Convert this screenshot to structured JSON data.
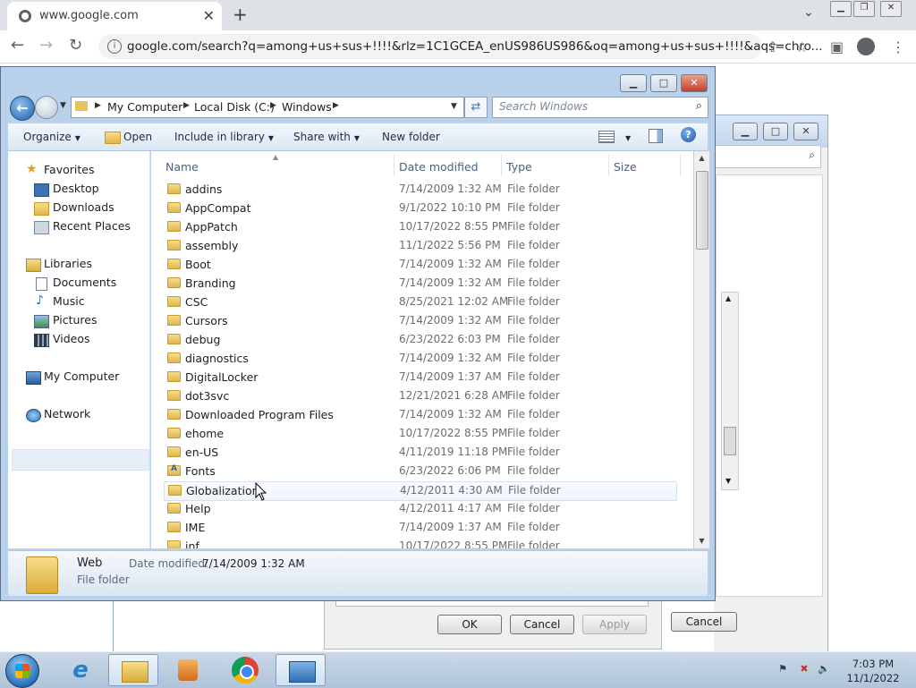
{
  "browser": {
    "tab_title": "www.google.com",
    "url": "google.com/search?q=among+us+sus+!!!!&rlz=1C1GCEA_enUS986US986&oq=among+us+sus+!!!!&aqs=chro..."
  },
  "background_dialog": {
    "ok_label": "OK",
    "cancel_label": "Cancel",
    "apply_label": "Apply",
    "outer_cancel_label": "Cancel"
  },
  "explorer": {
    "breadcrumbs": [
      "My Computer",
      "Local Disk (C:)",
      "Windows"
    ],
    "search_placeholder": "Search Windows",
    "commands": {
      "organize": "Organize",
      "open": "Open",
      "include_in_library": "Include in library",
      "share_with": "Share with",
      "new_folder": "New folder"
    },
    "nav": {
      "favorites": "Favorites",
      "desktop": "Desktop",
      "downloads": "Downloads",
      "recent_places": "Recent Places",
      "libraries": "Libraries",
      "documents": "Documents",
      "music": "Music",
      "pictures": "Pictures",
      "videos": "Videos",
      "my_computer": "My Computer",
      "network": "Network"
    },
    "columns": {
      "name": "Name",
      "date_modified": "Date modified",
      "type": "Type",
      "size": "Size"
    },
    "files": [
      {
        "name": "addins",
        "date": "7/14/2009 1:32 AM",
        "type": "File folder"
      },
      {
        "name": "AppCompat",
        "date": "9/1/2022 10:10 PM",
        "type": "File folder"
      },
      {
        "name": "AppPatch",
        "date": "10/17/2022 8:55 PM",
        "type": "File folder"
      },
      {
        "name": "assembly",
        "date": "11/1/2022 5:56 PM",
        "type": "File folder"
      },
      {
        "name": "Boot",
        "date": "7/14/2009 1:32 AM",
        "type": "File folder"
      },
      {
        "name": "Branding",
        "date": "7/14/2009 1:32 AM",
        "type": "File folder"
      },
      {
        "name": "CSC",
        "date": "8/25/2021 12:02 AM",
        "type": "File folder"
      },
      {
        "name": "Cursors",
        "date": "7/14/2009 1:32 AM",
        "type": "File folder"
      },
      {
        "name": "debug",
        "date": "6/23/2022 6:03 PM",
        "type": "File folder"
      },
      {
        "name": "diagnostics",
        "date": "7/14/2009 1:32 AM",
        "type": "File folder"
      },
      {
        "name": "DigitalLocker",
        "date": "7/14/2009 1:37 AM",
        "type": "File folder"
      },
      {
        "name": "dot3svc",
        "date": "12/21/2021 6:28 AM",
        "type": "File folder"
      },
      {
        "name": "Downloaded Program Files",
        "date": "7/14/2009 1:32 AM",
        "type": "File folder"
      },
      {
        "name": "ehome",
        "date": "10/17/2022 8:55 PM",
        "type": "File folder"
      },
      {
        "name": "en-US",
        "date": "4/11/2019 11:18 PM",
        "type": "File folder"
      },
      {
        "name": "Fonts",
        "date": "6/23/2022 6:06 PM",
        "type": "File folder"
      },
      {
        "name": "Globalization",
        "date": "4/12/2011 4:30 AM",
        "type": "File folder"
      },
      {
        "name": "Help",
        "date": "4/12/2011 4:17 AM",
        "type": "File folder"
      },
      {
        "name": "IME",
        "date": "7/14/2009 1:37 AM",
        "type": "File folder"
      },
      {
        "name": "inf",
        "date": "10/17/2022 8:55 PM",
        "type": "File folder"
      }
    ],
    "details": {
      "name": "Web",
      "type": "File folder",
      "date_label": "Date modified:",
      "date_value": "7/14/2009 1:32 AM"
    }
  },
  "taskbar": {
    "time": "7:03 PM",
    "date": "11/1/2022"
  }
}
